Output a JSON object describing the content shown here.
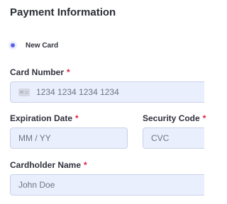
{
  "header": {
    "title": "Payment Information"
  },
  "payment_method": {
    "selected_option": "New Card",
    "selected": true
  },
  "fields": {
    "card_number": {
      "label": "Card Number",
      "required_mark": "*",
      "placeholder": "1234 1234 1234 1234",
      "value": "",
      "icon": "credit-card-icon"
    },
    "expiration": {
      "label": "Expiration Date",
      "required_mark": "*",
      "placeholder": "MM / YY",
      "value": ""
    },
    "security_code": {
      "label": "Security Code",
      "required_mark": "*",
      "placeholder": "CVC",
      "value": ""
    },
    "cardholder_name": {
      "label": "Cardholder Name",
      "required_mark": "*",
      "placeholder": "John Doe",
      "value": ""
    }
  },
  "colors": {
    "accent": "#5a63e6",
    "required": "#df1b41",
    "input_background": "#e9effd",
    "input_border": "#c9d0e8"
  }
}
